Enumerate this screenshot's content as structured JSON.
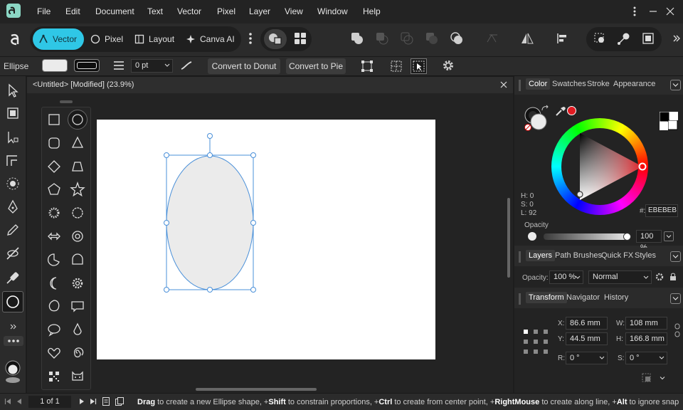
{
  "menu": [
    "File",
    "Edit",
    "Document",
    "Text",
    "Vector",
    "Pixel",
    "Layer",
    "View",
    "Window",
    "Help"
  ],
  "personas": {
    "vector": "Vector",
    "pixel": "Pixel",
    "layout": "Layout",
    "canva": "Canva AI"
  },
  "context": {
    "tool_name": "Ellipse",
    "stroke_width": "0 pt",
    "convert_donut": "Convert to Donut",
    "convert_pie": "Convert to Pie"
  },
  "document": {
    "title": "<Untitled> [Modified] (23.9%)"
  },
  "color_panel": {
    "tabs": [
      "Color",
      "Swatches",
      "Stroke",
      "Appearance"
    ],
    "h": "H: 0",
    "s": "S: 0",
    "l": "L: 92",
    "hex_label": "#:",
    "hex": "EBEBEB",
    "opacity_label": "Opacity",
    "opacity_value": "100 %",
    "fill_color": "#ebebeb",
    "accent": "#e11b22"
  },
  "layers_panel": {
    "tabs": [
      "Layers",
      "Path Brushes",
      "Quick FX",
      "Styles"
    ],
    "opacity_label": "Opacity:",
    "opacity": "100 %",
    "blend": "Normal"
  },
  "transform_panel": {
    "tabs": [
      "Transform",
      "Navigator",
      "History"
    ],
    "x_label": "X:",
    "x": "86.6 mm",
    "y_label": "Y:",
    "y": "44.5 mm",
    "w_label": "W:",
    "w": "108 mm",
    "h_label": "H:",
    "h": "166.8 mm",
    "r_label": "R:",
    "r": "0 °",
    "s_label": "S:",
    "s": "0 °"
  },
  "status": {
    "page": "1 of 1",
    "hint_parts": [
      {
        "b": "Drag",
        "t": " to create a new Ellipse shape, +"
      },
      {
        "b": "Shift",
        "t": " to constrain proportions, +"
      },
      {
        "b": "Ctrl",
        "t": " to create from center point, +"
      },
      {
        "b": "RightMouse",
        "t": " to create along line, +"
      },
      {
        "b": "Alt",
        "t": " to ignore snap"
      }
    ]
  },
  "colors": {
    "accent_cyan": "#2fc7e6",
    "selection": "#4a90d9"
  }
}
